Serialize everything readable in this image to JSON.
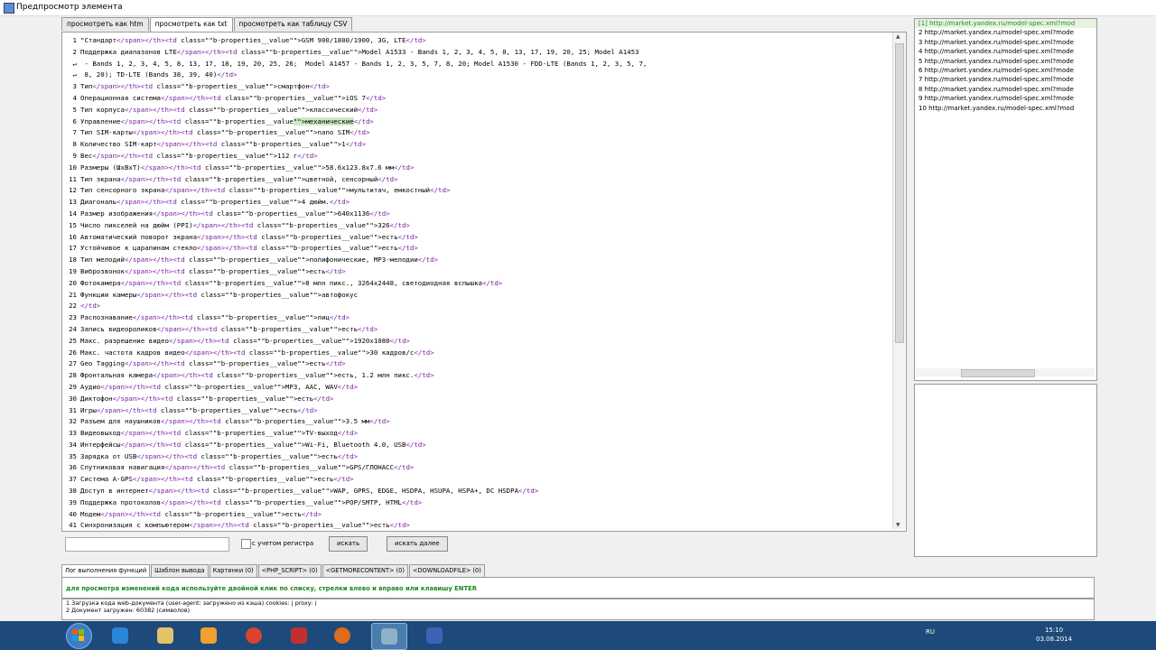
{
  "window": {
    "title": "Предпросмотр элемента"
  },
  "tabs": [
    "просмотреть как htm",
    "просмотреть как txt",
    "просмотреть как таблицу CSV"
  ],
  "code_lines": [
    {
      "n": "1",
      "parts": [
        [
          "t",
          "\"Стандарт"
        ],
        [
          "g",
          "</span></th><td"
        ],
        [
          "t",
          " class=\"\"b-properties__value\"\">GSM 900/1800/1900, 3G, LTE"
        ],
        [
          "g",
          "</td>"
        ]
      ]
    },
    {
      "n": "2",
      "parts": [
        [
          "t",
          "Поддержка диапазонов LTE"
        ],
        [
          "g",
          "</span></th><td"
        ],
        [
          "t",
          " class=\"\"b-properties__value\"\">Model A1533 - Bands 1, 2, 3, 4, 5, 8, 13, 17, 19, 20, 25; Model A1453"
        ]
      ]
    },
    {
      "n": "↵",
      "parts": [
        [
          "t",
          " - Bands 1, 2, 3, 4, 5, 8, 13, 17, 18, 19, 20, 25, 26;  Model A1457 - Bands 1, 2, 3, 5, 7, 8, 20; Model A1530 - FDD-LTE (Bands 1, 2, 3, 5, 7,"
        ]
      ]
    },
    {
      "n": "↵",
      "parts": [
        [
          "t",
          " 8, 20); TD-LTE (Bands 38, 39, 40)"
        ],
        [
          "g",
          "</td>"
        ]
      ]
    },
    {
      "n": "3",
      "parts": [
        [
          "t",
          "Тип"
        ],
        [
          "g",
          "</span></th><td"
        ],
        [
          "t",
          " class=\"\"b-properties__value\"\">смартфон"
        ],
        [
          "g",
          "</td>"
        ]
      ]
    },
    {
      "n": "4",
      "parts": [
        [
          "t",
          "Операционная система"
        ],
        [
          "g",
          "</span></th><td"
        ],
        [
          "t",
          " class=\"\"b-properties__value\"\">iOS 7"
        ],
        [
          "g",
          "</td>"
        ]
      ]
    },
    {
      "n": "5",
      "parts": [
        [
          "t",
          "Тип корпуса"
        ],
        [
          "g",
          "</span></th><td"
        ],
        [
          "t",
          " class=\"\"b-properties__value\"\">классический"
        ],
        [
          "g",
          "</td>"
        ]
      ]
    },
    {
      "n": "6",
      "parts": [
        [
          "t",
          "Управление"
        ],
        [
          "g",
          "</span></th><td"
        ],
        [
          "t",
          " class=\"\"b-properties__value"
        ],
        [
          "h",
          "\"\">механические"
        ],
        [
          "g",
          "</td>"
        ]
      ]
    },
    {
      "n": "7",
      "parts": [
        [
          "t",
          "Тип SIM-карты"
        ],
        [
          "g",
          "</span></th><td"
        ],
        [
          "t",
          " class=\"\"b-properties__value\"\">nano SIM"
        ],
        [
          "g",
          "</td>"
        ]
      ]
    },
    {
      "n": "8",
      "parts": [
        [
          "t",
          "Количество SIM-карт"
        ],
        [
          "g",
          "</span></th><td"
        ],
        [
          "t",
          " class=\"\"b-properties__value\"\">1"
        ],
        [
          "g",
          "</td>"
        ]
      ]
    },
    {
      "n": "9",
      "parts": [
        [
          "t",
          "Вес"
        ],
        [
          "g",
          "</span></th><td"
        ],
        [
          "t",
          " class=\"\"b-properties__value\"\">112 г"
        ],
        [
          "g",
          "</td>"
        ]
      ]
    },
    {
      "n": "10",
      "parts": [
        [
          "t",
          "Размеры (ШxВxТ)"
        ],
        [
          "g",
          "</span></th><td"
        ],
        [
          "t",
          " class=\"\"b-properties__value\"\">58.6x123.8x7.6 мм"
        ],
        [
          "g",
          "</td>"
        ]
      ]
    },
    {
      "n": "11",
      "parts": [
        [
          "t",
          "Тип экрана"
        ],
        [
          "g",
          "</span></th><td"
        ],
        [
          "t",
          " class=\"\"b-properties__value\"\">цветной, сенсорный"
        ],
        [
          "g",
          "</td>"
        ]
      ]
    },
    {
      "n": "12",
      "parts": [
        [
          "t",
          "Тип сенсорного экрана"
        ],
        [
          "g",
          "</span></th><td"
        ],
        [
          "t",
          " class=\"\"b-properties__value\"\">мультитач, емкостный"
        ],
        [
          "g",
          "</td>"
        ]
      ]
    },
    {
      "n": "13",
      "parts": [
        [
          "t",
          "Диагональ"
        ],
        [
          "g",
          "</span></th><td"
        ],
        [
          "t",
          " class=\"\"b-properties__value\"\">4 дюйм."
        ],
        [
          "g",
          "</td>"
        ]
      ]
    },
    {
      "n": "14",
      "parts": [
        [
          "t",
          "Размер изображения"
        ],
        [
          "g",
          "</span></th><td"
        ],
        [
          "t",
          " class=\"\"b-properties__value\"\">640x1136"
        ],
        [
          "g",
          "</td>"
        ]
      ]
    },
    {
      "n": "15",
      "parts": [
        [
          "t",
          "Число пикселей на дюйм (PPI)"
        ],
        [
          "g",
          "</span></th><td"
        ],
        [
          "t",
          " class=\"\"b-properties__value\"\">326"
        ],
        [
          "g",
          "</td>"
        ]
      ]
    },
    {
      "n": "16",
      "parts": [
        [
          "t",
          "Автоматический поворот экрана"
        ],
        [
          "g",
          "</span></th><td"
        ],
        [
          "t",
          " class=\"\"b-properties__value\"\">есть"
        ],
        [
          "g",
          "</td>"
        ]
      ]
    },
    {
      "n": "17",
      "parts": [
        [
          "t",
          "Устойчивое к царапинам стекло"
        ],
        [
          "g",
          "</span></th><td"
        ],
        [
          "t",
          " class=\"\"b-properties__value\"\">есть"
        ],
        [
          "g",
          "</td>"
        ]
      ]
    },
    {
      "n": "18",
      "parts": [
        [
          "t",
          "Тип мелодий"
        ],
        [
          "g",
          "</span></th><td"
        ],
        [
          "t",
          " class=\"\"b-properties__value\"\">полифонические, MP3-мелодии"
        ],
        [
          "g",
          "</td>"
        ]
      ]
    },
    {
      "n": "19",
      "parts": [
        [
          "t",
          "Виброзвонок"
        ],
        [
          "g",
          "</span></th><td"
        ],
        [
          "t",
          " class=\"\"b-properties__value\"\">есть"
        ],
        [
          "g",
          "</td>"
        ]
      ]
    },
    {
      "n": "20",
      "parts": [
        [
          "t",
          "Фотокамера"
        ],
        [
          "g",
          "</span></th><td"
        ],
        [
          "t",
          " class=\"\"b-properties__value\"\">8 млн пикс., 3264x2448, светодиодная вспышка"
        ],
        [
          "g",
          "</td>"
        ]
      ]
    },
    {
      "n": "21",
      "parts": [
        [
          "t",
          "Функции камеры"
        ],
        [
          "g",
          "</span></th><td"
        ],
        [
          "t",
          " class=\"\"b-properties__value\"\">автофокус"
        ]
      ]
    },
    {
      "n": "22",
      "parts": [
        [
          "g",
          "</td>"
        ]
      ]
    },
    {
      "n": "23",
      "parts": [
        [
          "t",
          "Распознавание"
        ],
        [
          "g",
          "</span></th><td"
        ],
        [
          "t",
          " class=\"\"b-properties__value\"\">лиц"
        ],
        [
          "g",
          "</td>"
        ]
      ]
    },
    {
      "n": "24",
      "parts": [
        [
          "t",
          "Запись видеороликов"
        ],
        [
          "g",
          "</span></th><td"
        ],
        [
          "t",
          " class=\"\"b-properties__value\"\">есть"
        ],
        [
          "g",
          "</td>"
        ]
      ]
    },
    {
      "n": "25",
      "parts": [
        [
          "t",
          "Макс. разрешение видео"
        ],
        [
          "g",
          "</span></th><td"
        ],
        [
          "t",
          " class=\"\"b-properties__value\"\">1920x1080"
        ],
        [
          "g",
          "</td>"
        ]
      ]
    },
    {
      "n": "26",
      "parts": [
        [
          "t",
          "Макс. частота кадров видео"
        ],
        [
          "g",
          "</span></th><td"
        ],
        [
          "t",
          " class=\"\"b-properties__value\"\">30 кадров/с"
        ],
        [
          "g",
          "</td>"
        ]
      ]
    },
    {
      "n": "27",
      "parts": [
        [
          "t",
          "Geo Tagging"
        ],
        [
          "g",
          "</span></th><td"
        ],
        [
          "t",
          " class=\"\"b-properties__value\"\">есть"
        ],
        [
          "g",
          "</td>"
        ]
      ]
    },
    {
      "n": "28",
      "parts": [
        [
          "t",
          "Фронтальная камера"
        ],
        [
          "g",
          "</span></th><td"
        ],
        [
          "t",
          " class=\"\"b-properties__value\"\">есть, 1.2 млн пикс."
        ],
        [
          "g",
          "</td>"
        ]
      ]
    },
    {
      "n": "29",
      "parts": [
        [
          "t",
          "Аудио"
        ],
        [
          "g",
          "</span></th><td"
        ],
        [
          "t",
          " class=\"\"b-properties__value\"\">MP3, AAC, WAV"
        ],
        [
          "g",
          "</td>"
        ]
      ]
    },
    {
      "n": "30",
      "parts": [
        [
          "t",
          "Диктофон"
        ],
        [
          "g",
          "</span></th><td"
        ],
        [
          "t",
          " class=\"\"b-properties__value\"\">есть"
        ],
        [
          "g",
          "</td>"
        ]
      ]
    },
    {
      "n": "31",
      "parts": [
        [
          "t",
          "Игры"
        ],
        [
          "g",
          "</span></th><td"
        ],
        [
          "t",
          " class=\"\"b-properties__value\"\">есть"
        ],
        [
          "g",
          "</td>"
        ]
      ]
    },
    {
      "n": "32",
      "parts": [
        [
          "t",
          "Разъем для наушников"
        ],
        [
          "g",
          "</span></th><td"
        ],
        [
          "t",
          " class=\"\"b-properties__value\"\">3.5 мм"
        ],
        [
          "g",
          "</td>"
        ]
      ]
    },
    {
      "n": "33",
      "parts": [
        [
          "t",
          "Видеовыход"
        ],
        [
          "g",
          "</span></th><td"
        ],
        [
          "t",
          " class=\"\"b-properties__value\"\">TV-выход"
        ],
        [
          "g",
          "</td>"
        ]
      ]
    },
    {
      "n": "34",
      "parts": [
        [
          "t",
          "Интерфейсы"
        ],
        [
          "g",
          "</span></th><td"
        ],
        [
          "t",
          " class=\"\"b-properties__value\"\">Wi-Fi, Bluetooth 4.0, USB"
        ],
        [
          "g",
          "</td>"
        ]
      ]
    },
    {
      "n": "35",
      "parts": [
        [
          "t",
          "Зарядка от USB"
        ],
        [
          "g",
          "</span></th><td"
        ],
        [
          "t",
          " class=\"\"b-properties__value\"\">есть"
        ],
        [
          "g",
          "</td>"
        ]
      ]
    },
    {
      "n": "36",
      "parts": [
        [
          "t",
          "Спутниковая навигация"
        ],
        [
          "g",
          "</span></th><td"
        ],
        [
          "t",
          " class=\"\"b-properties__value\"\">GPS/ГЛОНАСС"
        ],
        [
          "g",
          "</td>"
        ]
      ]
    },
    {
      "n": "37",
      "parts": [
        [
          "t",
          "Система A-GPS"
        ],
        [
          "g",
          "</span></th><td"
        ],
        [
          "t",
          " class=\"\"b-properties__value\"\">есть"
        ],
        [
          "g",
          "</td>"
        ]
      ]
    },
    {
      "n": "38",
      "parts": [
        [
          "t",
          "Доступ в интернет"
        ],
        [
          "g",
          "</span></th><td"
        ],
        [
          "t",
          " class=\"\"b-properties__value\"\">WAP, GPRS, EDGE, HSDPA, HSUPA, HSPA+, DC HSDPA"
        ],
        [
          "g",
          "</td>"
        ]
      ]
    },
    {
      "n": "39",
      "parts": [
        [
          "t",
          "Поддержка протоколов"
        ],
        [
          "g",
          "</span></th><td"
        ],
        [
          "t",
          " class=\"\"b-properties__value\"\">POP/SMTP, HTML"
        ],
        [
          "g",
          "</td>"
        ]
      ]
    },
    {
      "n": "40",
      "parts": [
        [
          "t",
          "Модем"
        ],
        [
          "g",
          "</span></th><td"
        ],
        [
          "t",
          " class=\"\"b-properties__value\"\">есть"
        ],
        [
          "g",
          "</td>"
        ]
      ]
    },
    {
      "n": "41",
      "parts": [
        [
          "t",
          "Синхронизация с компьютером"
        ],
        [
          "g",
          "</span></th><td"
        ],
        [
          "t",
          " class=\"\"b-properties__value\"\">есть"
        ],
        [
          "g",
          "</td>"
        ]
      ]
    }
  ],
  "search": {
    "case_label": "с учетом регистра",
    "find_label": "искать",
    "find_next_label": "искать далее"
  },
  "url_list": [
    "[1]  http://market.yandex.ru/model-spec.xml?mod",
    "2   http://market.yandex.ru/model-spec.xml?mode",
    "3   http://market.yandex.ru/model-spec.xml?mode",
    "4   http://market.yandex.ru/model-spec.xml?mode",
    "5   http://market.yandex.ru/model-spec.xml?mode",
    "6   http://market.yandex.ru/model-spec.xml?mode",
    "7   http://market.yandex.ru/model-spec.xml?mode",
    "8   http://market.yandex.ru/model-spec.xml?mode",
    "9   http://market.yandex.ru/model-spec.xml?mode",
    "10  http://market.yandex.ru/model-spec.xml?mod"
  ],
  "bottom_tabs": [
    "Лог выполнения функций",
    "Шаблон вывода",
    "Картинки (0)",
    "<PHP_SCRIPT> (0)",
    "<GETMORECONTENT> (0)",
    "<DOWNLOADFILE> (0)"
  ],
  "info_text": "для просмотра изменений кода используйте двойной клик по списку, стрелки влево и вправо или клавишу ENTER",
  "log_lines": [
    "1  Загрузка кода web-документа (user-agent: загружено из кэша) cookies: | proxy: )",
    "2  Документ загружен: 60382 (символов)"
  ],
  "taskbar": {
    "lang": "RU",
    "time": "15:10",
    "date": "03.08.2014"
  },
  "colors": {
    "tag": "#7a1fa2",
    "info": "#1a8a1a",
    "taskbar": "#1d4a7a"
  }
}
